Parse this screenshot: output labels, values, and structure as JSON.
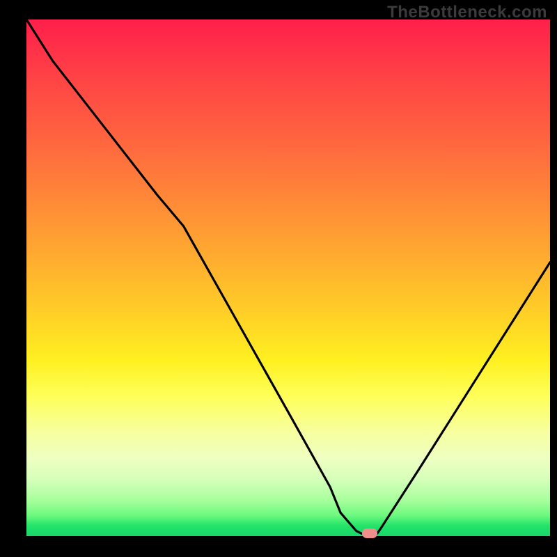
{
  "watermark": "TheBottleneck.com",
  "colors": {
    "background": "#000000",
    "gradient_top": "#ff1f4b",
    "gradient_bottom": "#19d66a",
    "curve_stroke": "#000000",
    "marker_fill": "#ef8f8b",
    "watermark_text": "#3b3b3b"
  },
  "chart_data": {
    "type": "line",
    "title": "",
    "xlabel": "",
    "ylabel": "",
    "xlim": [
      0,
      100
    ],
    "ylim": [
      0,
      100
    ],
    "series": [
      {
        "name": "curve",
        "x": [
          0,
          5,
          15,
          25,
          30,
          40,
          50,
          58,
          60,
          63,
          64,
          67,
          68,
          75,
          85,
          95,
          100
        ],
        "values": [
          100,
          92,
          79,
          66,
          60,
          42,
          24,
          9.5,
          4.5,
          1.0,
          0.5,
          0.5,
          2.0,
          13,
          29,
          45,
          53
        ]
      }
    ],
    "marker": {
      "x": 65.5,
      "y": 0.5
    },
    "annotations": []
  }
}
